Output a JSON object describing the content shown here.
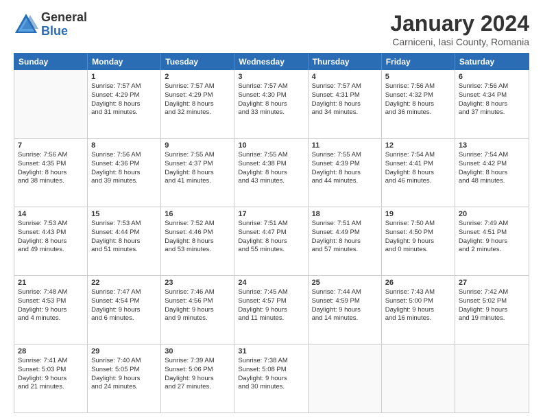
{
  "logo": {
    "general": "General",
    "blue": "Blue"
  },
  "title": "January 2024",
  "subtitle": "Carniceni, Iasi County, Romania",
  "days": [
    "Sunday",
    "Monday",
    "Tuesday",
    "Wednesday",
    "Thursday",
    "Friday",
    "Saturday"
  ],
  "weeks": [
    [
      {
        "num": "",
        "lines": []
      },
      {
        "num": "1",
        "lines": [
          "Sunrise: 7:57 AM",
          "Sunset: 4:29 PM",
          "Daylight: 8 hours",
          "and 31 minutes."
        ]
      },
      {
        "num": "2",
        "lines": [
          "Sunrise: 7:57 AM",
          "Sunset: 4:29 PM",
          "Daylight: 8 hours",
          "and 32 minutes."
        ]
      },
      {
        "num": "3",
        "lines": [
          "Sunrise: 7:57 AM",
          "Sunset: 4:30 PM",
          "Daylight: 8 hours",
          "and 33 minutes."
        ]
      },
      {
        "num": "4",
        "lines": [
          "Sunrise: 7:57 AM",
          "Sunset: 4:31 PM",
          "Daylight: 8 hours",
          "and 34 minutes."
        ]
      },
      {
        "num": "5",
        "lines": [
          "Sunrise: 7:56 AM",
          "Sunset: 4:32 PM",
          "Daylight: 8 hours",
          "and 36 minutes."
        ]
      },
      {
        "num": "6",
        "lines": [
          "Sunrise: 7:56 AM",
          "Sunset: 4:34 PM",
          "Daylight: 8 hours",
          "and 37 minutes."
        ]
      }
    ],
    [
      {
        "num": "7",
        "lines": [
          "Sunrise: 7:56 AM",
          "Sunset: 4:35 PM",
          "Daylight: 8 hours",
          "and 38 minutes."
        ]
      },
      {
        "num": "8",
        "lines": [
          "Sunrise: 7:56 AM",
          "Sunset: 4:36 PM",
          "Daylight: 8 hours",
          "and 39 minutes."
        ]
      },
      {
        "num": "9",
        "lines": [
          "Sunrise: 7:55 AM",
          "Sunset: 4:37 PM",
          "Daylight: 8 hours",
          "and 41 minutes."
        ]
      },
      {
        "num": "10",
        "lines": [
          "Sunrise: 7:55 AM",
          "Sunset: 4:38 PM",
          "Daylight: 8 hours",
          "and 43 minutes."
        ]
      },
      {
        "num": "11",
        "lines": [
          "Sunrise: 7:55 AM",
          "Sunset: 4:39 PM",
          "Daylight: 8 hours",
          "and 44 minutes."
        ]
      },
      {
        "num": "12",
        "lines": [
          "Sunrise: 7:54 AM",
          "Sunset: 4:41 PM",
          "Daylight: 8 hours",
          "and 46 minutes."
        ]
      },
      {
        "num": "13",
        "lines": [
          "Sunrise: 7:54 AM",
          "Sunset: 4:42 PM",
          "Daylight: 8 hours",
          "and 48 minutes."
        ]
      }
    ],
    [
      {
        "num": "14",
        "lines": [
          "Sunrise: 7:53 AM",
          "Sunset: 4:43 PM",
          "Daylight: 8 hours",
          "and 49 minutes."
        ]
      },
      {
        "num": "15",
        "lines": [
          "Sunrise: 7:53 AM",
          "Sunset: 4:44 PM",
          "Daylight: 8 hours",
          "and 51 minutes."
        ]
      },
      {
        "num": "16",
        "lines": [
          "Sunrise: 7:52 AM",
          "Sunset: 4:46 PM",
          "Daylight: 8 hours",
          "and 53 minutes."
        ]
      },
      {
        "num": "17",
        "lines": [
          "Sunrise: 7:51 AM",
          "Sunset: 4:47 PM",
          "Daylight: 8 hours",
          "and 55 minutes."
        ]
      },
      {
        "num": "18",
        "lines": [
          "Sunrise: 7:51 AM",
          "Sunset: 4:49 PM",
          "Daylight: 8 hours",
          "and 57 minutes."
        ]
      },
      {
        "num": "19",
        "lines": [
          "Sunrise: 7:50 AM",
          "Sunset: 4:50 PM",
          "Daylight: 9 hours",
          "and 0 minutes."
        ]
      },
      {
        "num": "20",
        "lines": [
          "Sunrise: 7:49 AM",
          "Sunset: 4:51 PM",
          "Daylight: 9 hours",
          "and 2 minutes."
        ]
      }
    ],
    [
      {
        "num": "21",
        "lines": [
          "Sunrise: 7:48 AM",
          "Sunset: 4:53 PM",
          "Daylight: 9 hours",
          "and 4 minutes."
        ]
      },
      {
        "num": "22",
        "lines": [
          "Sunrise: 7:47 AM",
          "Sunset: 4:54 PM",
          "Daylight: 9 hours",
          "and 6 minutes."
        ]
      },
      {
        "num": "23",
        "lines": [
          "Sunrise: 7:46 AM",
          "Sunset: 4:56 PM",
          "Daylight: 9 hours",
          "and 9 minutes."
        ]
      },
      {
        "num": "24",
        "lines": [
          "Sunrise: 7:45 AM",
          "Sunset: 4:57 PM",
          "Daylight: 9 hours",
          "and 11 minutes."
        ]
      },
      {
        "num": "25",
        "lines": [
          "Sunrise: 7:44 AM",
          "Sunset: 4:59 PM",
          "Daylight: 9 hours",
          "and 14 minutes."
        ]
      },
      {
        "num": "26",
        "lines": [
          "Sunrise: 7:43 AM",
          "Sunset: 5:00 PM",
          "Daylight: 9 hours",
          "and 16 minutes."
        ]
      },
      {
        "num": "27",
        "lines": [
          "Sunrise: 7:42 AM",
          "Sunset: 5:02 PM",
          "Daylight: 9 hours",
          "and 19 minutes."
        ]
      }
    ],
    [
      {
        "num": "28",
        "lines": [
          "Sunrise: 7:41 AM",
          "Sunset: 5:03 PM",
          "Daylight: 9 hours",
          "and 21 minutes."
        ]
      },
      {
        "num": "29",
        "lines": [
          "Sunrise: 7:40 AM",
          "Sunset: 5:05 PM",
          "Daylight: 9 hours",
          "and 24 minutes."
        ]
      },
      {
        "num": "30",
        "lines": [
          "Sunrise: 7:39 AM",
          "Sunset: 5:06 PM",
          "Daylight: 9 hours",
          "and 27 minutes."
        ]
      },
      {
        "num": "31",
        "lines": [
          "Sunrise: 7:38 AM",
          "Sunset: 5:08 PM",
          "Daylight: 9 hours",
          "and 30 minutes."
        ]
      },
      {
        "num": "",
        "lines": []
      },
      {
        "num": "",
        "lines": []
      },
      {
        "num": "",
        "lines": []
      }
    ]
  ]
}
